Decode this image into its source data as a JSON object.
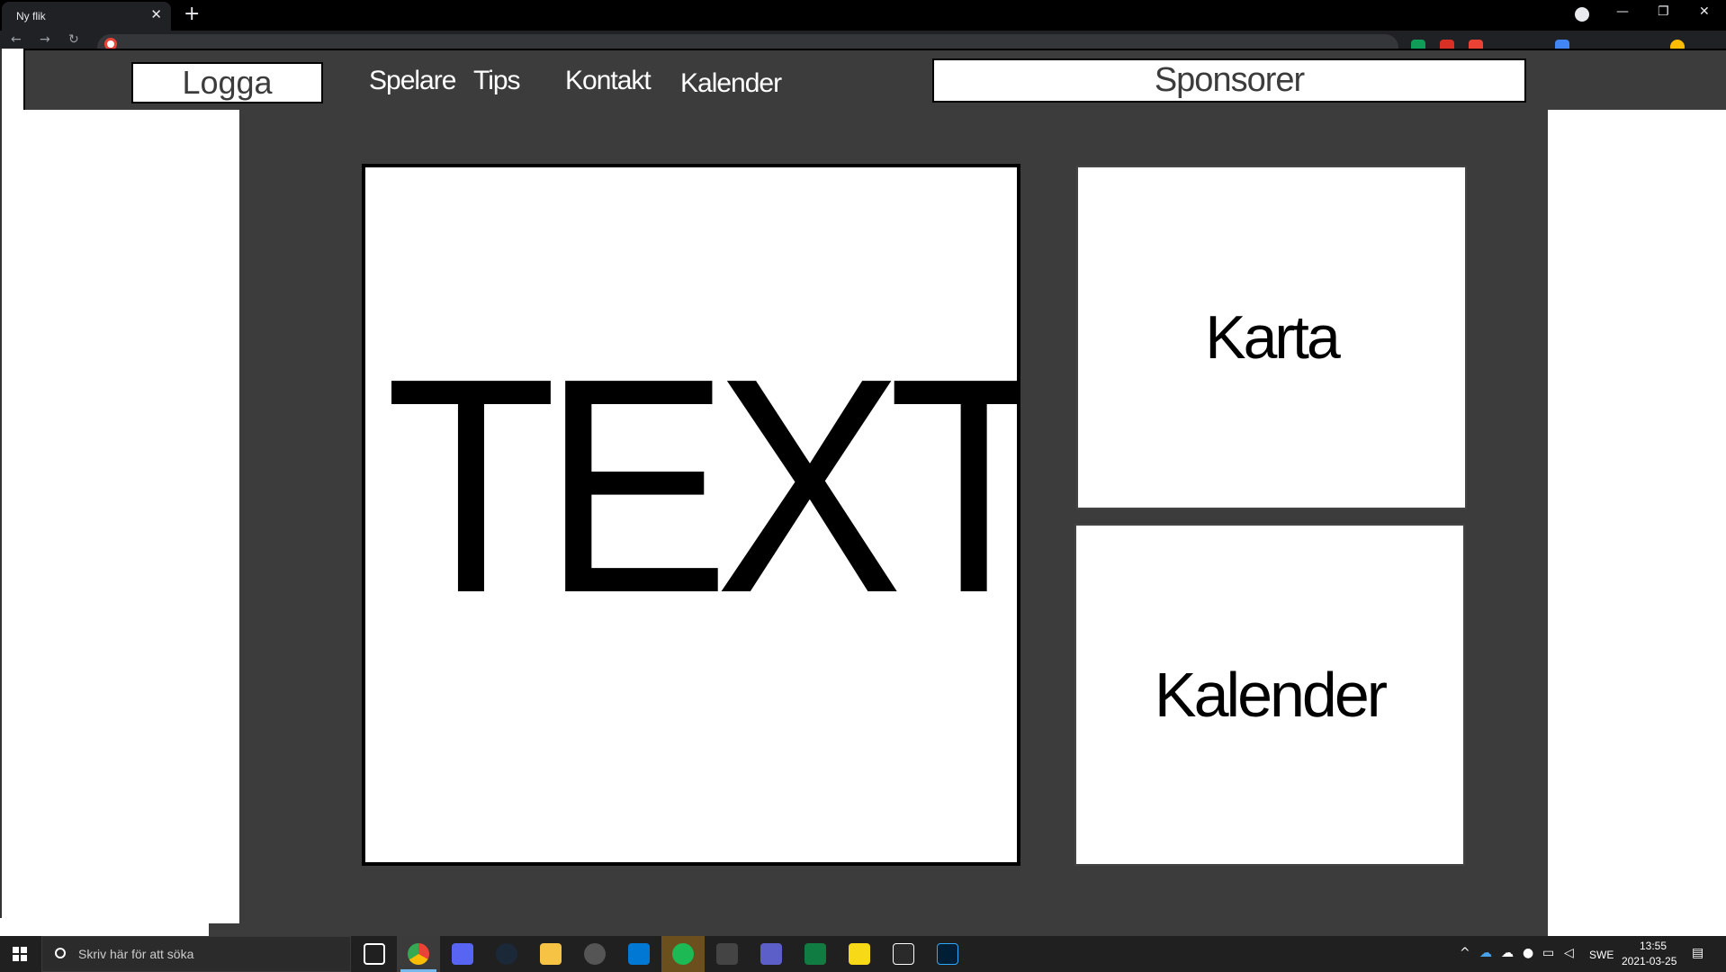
{
  "browser": {
    "tab_title": "Ny flik",
    "tab_close": "✕",
    "new_tab": "+",
    "window_controls": {
      "minimize": "—",
      "restore": "❐",
      "close": "✕"
    },
    "nav": {
      "back": "←",
      "forward": "→",
      "reload": "↻"
    }
  },
  "site": {
    "logo_label": "Logga",
    "nav_links": [
      "Spelare",
      "Tips",
      "Kontakt",
      "Kalender"
    ],
    "sponsors_label": "Sponsorer",
    "main_text": "TEXT",
    "map_card": "Karta",
    "calendar_card": "Kalender"
  },
  "taskbar": {
    "search_placeholder": "Skriv här för att söka",
    "language": "SWE",
    "time": "13:55",
    "date": "2021-03-25",
    "apps": [
      "task-view",
      "chrome",
      "discord",
      "steam",
      "file-explorer",
      "obs",
      "mail",
      "spotify",
      "battlenet",
      "teams",
      "excel",
      "sticky-notes",
      "epic-games",
      "photoshop"
    ]
  },
  "colors": {
    "page_bg": "#ffffff",
    "nav_bg": "#3c3c3c",
    "card_bg": "#ffffff",
    "text": "#000000"
  }
}
